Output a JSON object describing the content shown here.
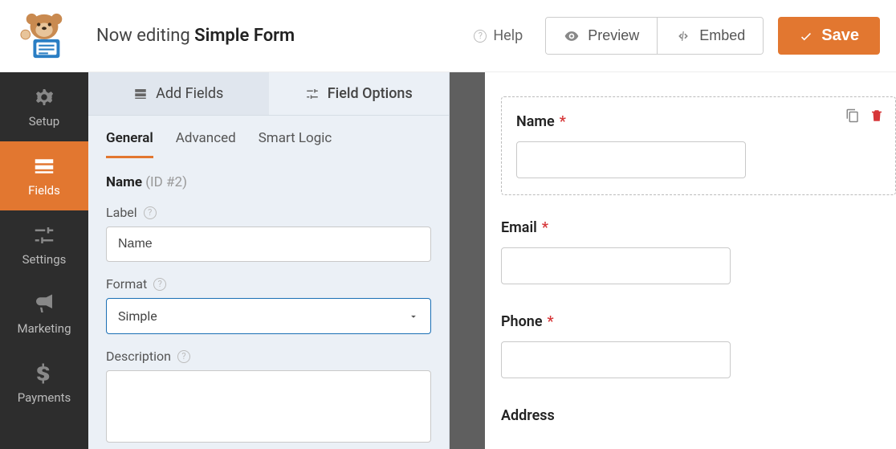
{
  "header": {
    "title_prefix": "Now editing ",
    "title_bold": "Simple Form",
    "help": "Help",
    "preview": "Preview",
    "embed": "Embed",
    "save": "Save"
  },
  "sidebar": {
    "items": [
      {
        "id": "setup",
        "label": "Setup"
      },
      {
        "id": "fields",
        "label": "Fields"
      },
      {
        "id": "settings",
        "label": "Settings"
      },
      {
        "id": "marketing",
        "label": "Marketing"
      },
      {
        "id": "payments",
        "label": "Payments"
      }
    ],
    "active": "fields"
  },
  "panel": {
    "tabs": {
      "add": "Add Fields",
      "options": "Field Options",
      "active": "options"
    },
    "sub_tabs": {
      "general": "General",
      "advanced": "Advanced",
      "smart": "Smart Logic",
      "active": "general"
    },
    "section": {
      "title": "Name",
      "id_text": "(ID #2)"
    },
    "fields": {
      "label": {
        "label": "Label",
        "value": "Name"
      },
      "format": {
        "label": "Format",
        "value": "Simple"
      },
      "description": {
        "label": "Description",
        "value": ""
      }
    }
  },
  "preview": {
    "fields": [
      {
        "label": "Name",
        "required": true,
        "selected": true
      },
      {
        "label": "Email",
        "required": true,
        "selected": false
      },
      {
        "label": "Phone",
        "required": true,
        "selected": false
      },
      {
        "label": "Address",
        "required": false,
        "selected": false
      }
    ]
  }
}
